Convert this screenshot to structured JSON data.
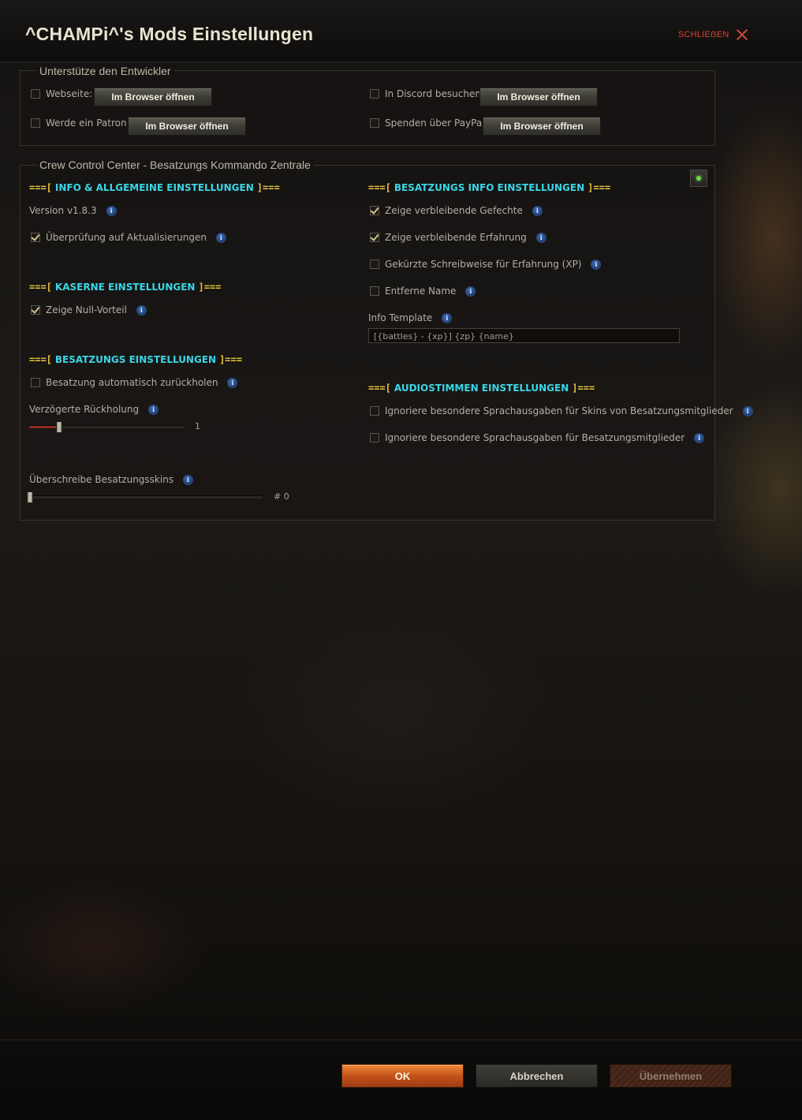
{
  "window": {
    "title": "^CHAMPi^'s Mods Einstellungen",
    "close_label": "SCHLIEẞEN"
  },
  "support": {
    "title": "Unterstütze den Entwickler",
    "items": [
      {
        "label": "Webseite:",
        "button": "Im Browser öffnen",
        "checked": false
      },
      {
        "label": "Werde ein Patron:",
        "button": "Im Browser öffnen",
        "checked": false
      },
      {
        "label": "In Discord besuchen:",
        "button": "Im Browser öffnen",
        "checked": false
      },
      {
        "label": "Spenden über PayPal:",
        "button": "Im Browser öffnen",
        "checked": false
      }
    ]
  },
  "crew": {
    "title": "Crew Control Center - Besatzungs Kommando Zentrale",
    "prefix": "===[",
    "suffix": "]===",
    "info_section": {
      "heading": "INFO & ALLGEMEINE EINSTELLUNGEN",
      "version": "Version v1.8.3",
      "update_check": {
        "label": "Überprüfung auf Aktualisierungen",
        "checked": true
      }
    },
    "barracks_section": {
      "heading": "KASERNE EINSTELLUNGEN",
      "zero_perk": {
        "label": "Zeige Null-Vorteil",
        "checked": true
      }
    },
    "crew_section": {
      "heading": "BESATZUNGS EINSTELLUNGEN",
      "auto_return": {
        "label": "Besatzung automatisch zurückholen",
        "checked": false
      },
      "delayed_return": {
        "label": "Verzögerte Rückholung",
        "value": "1",
        "level": 0.19
      },
      "skin_override": {
        "label": "Überschreibe Besatzungsskins",
        "value": "# 0",
        "level": 0.0
      }
    },
    "crew_info_section": {
      "heading": "BESATZUNGS INFO EINSTELLUNGEN",
      "items": [
        {
          "label": "Zeige verbleibende Gefechte",
          "checked": true
        },
        {
          "label": "Zeige verbleibende Erfahrung",
          "checked": true
        },
        {
          "label": "Gekürzte Schreibweise für Erfahrung (XP)",
          "checked": false
        },
        {
          "label": "Entferne Name",
          "checked": false
        }
      ],
      "template_label": "Info Template",
      "template_value": "[{battles} - {xp}] {zp} {name}"
    },
    "audio_section": {
      "heading": "AUDIOSTIMMEN EINSTELLUNGEN",
      "items": [
        {
          "label": "Ignoriere besondere Sprachausgaben für Skins von Besatzungsmitglieder",
          "checked": false
        },
        {
          "label": "Ignoriere besondere Sprachausgaben für Besatzungsmitglieder",
          "checked": false
        }
      ]
    }
  },
  "footer": {
    "ok": "OK",
    "cancel": "Abbrechen",
    "apply": "Übernehmen"
  },
  "colors": {
    "accent_heading": "#3ad6e6",
    "deco": "#e8c33a",
    "ok_button": "#e07030",
    "close": "#e0402a"
  }
}
